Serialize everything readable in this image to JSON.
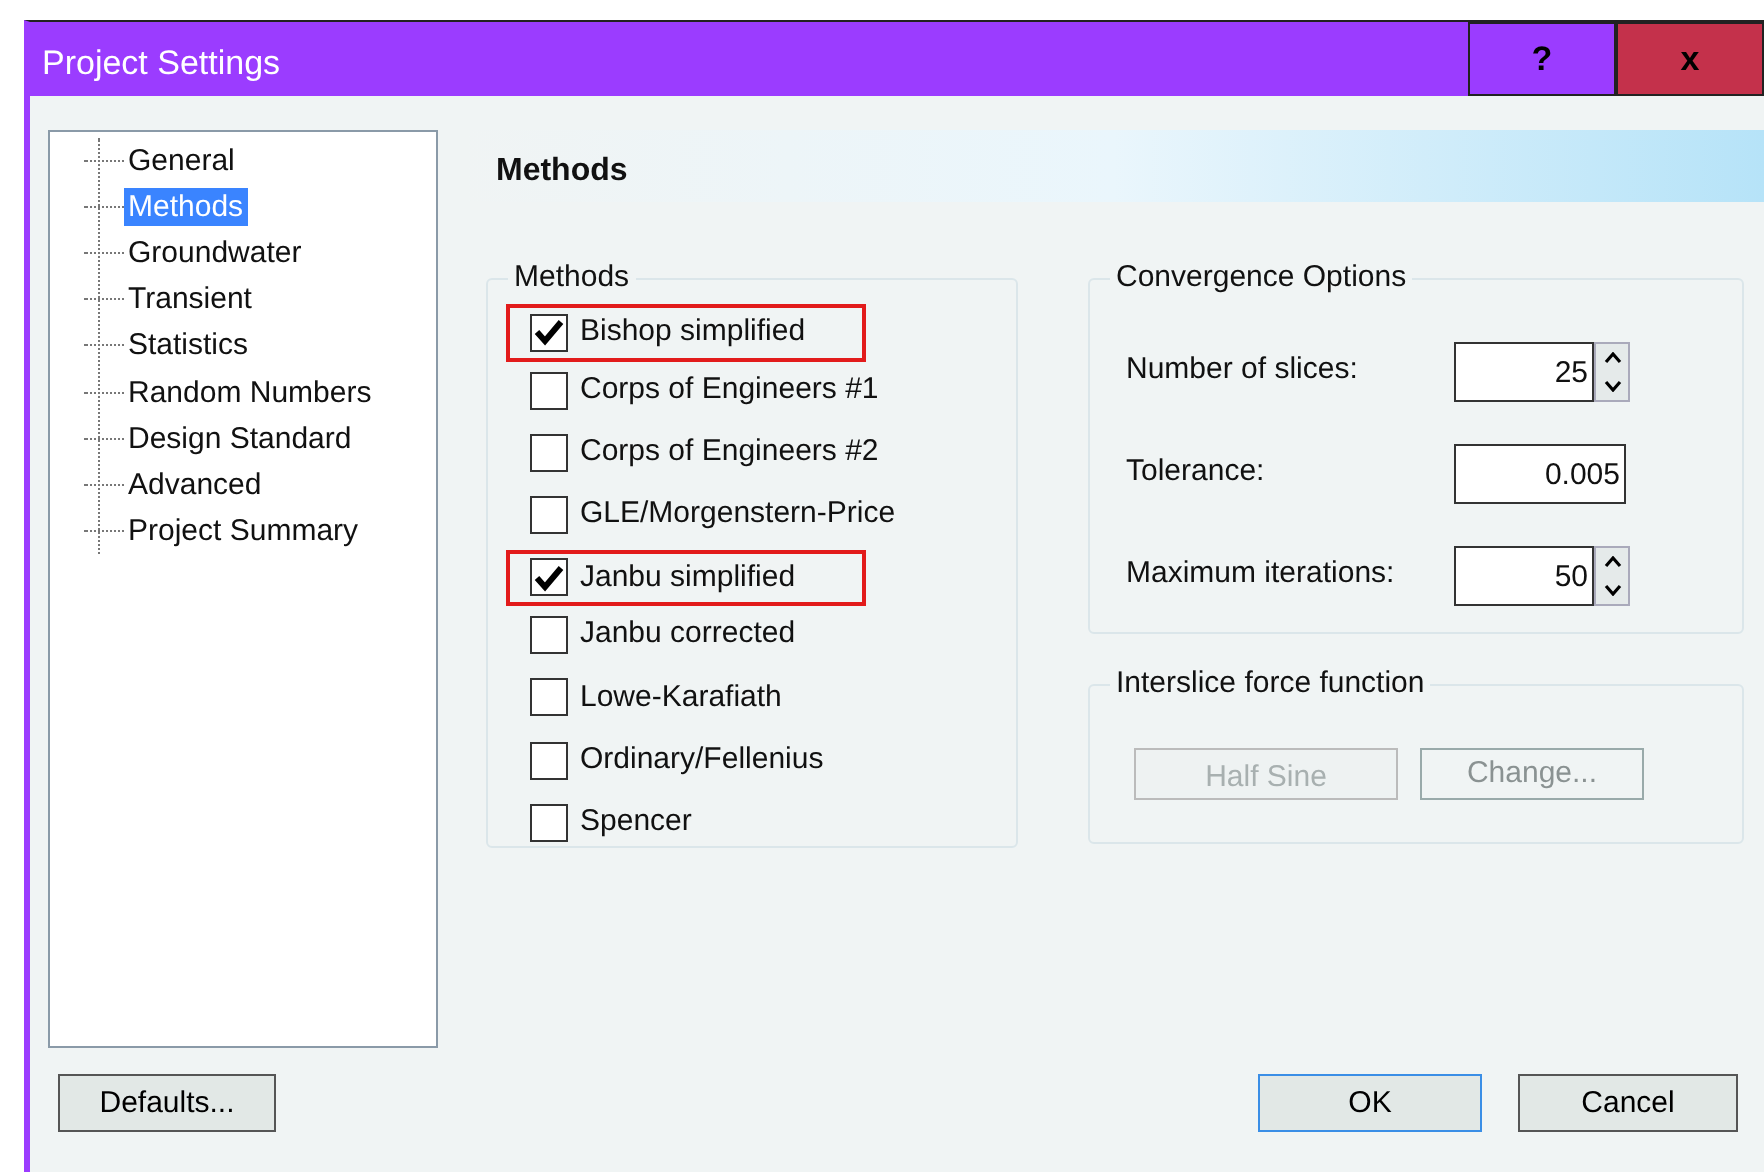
{
  "window": {
    "title": "Project Settings",
    "buttons": [
      "?",
      "x"
    ]
  },
  "sidebar": {
    "items": [
      {
        "label": "General",
        "selected": false
      },
      {
        "label": "Methods",
        "selected": true
      },
      {
        "label": "Groundwater",
        "selected": false
      },
      {
        "label": "Transient",
        "selected": false
      },
      {
        "label": "Statistics",
        "selected": false
      },
      {
        "label": "Random Numbers",
        "selected": false
      },
      {
        "label": "Design Standard",
        "selected": false
      },
      {
        "label": "Advanced",
        "selected": false
      },
      {
        "label": "Project Summary",
        "selected": false
      }
    ]
  },
  "page_title": "Methods",
  "methods": {
    "title": "Methods",
    "items": [
      {
        "label": "Bishop simplified",
        "checked": true,
        "highlighted": true
      },
      {
        "label": "Corps of Engineers #1",
        "checked": false,
        "highlighted": false
      },
      {
        "label": "Corps of Engineers #2",
        "checked": false,
        "highlighted": false
      },
      {
        "label": "GLE/Morgenstern-Price",
        "checked": false,
        "highlighted": false
      },
      {
        "label": "Janbu simplified",
        "checked": true,
        "highlighted": true
      },
      {
        "label": "Janbu corrected",
        "checked": false,
        "highlighted": false
      },
      {
        "label": "Lowe-Karafiath",
        "checked": false,
        "highlighted": false
      },
      {
        "label": "Ordinary/Fellenius",
        "checked": false,
        "highlighted": false
      },
      {
        "label": "Spencer",
        "checked": false,
        "highlighted": false
      }
    ]
  },
  "convergence": {
    "title": "Convergence Options",
    "fields": [
      {
        "label": "Number of slices:",
        "value": "25",
        "kind": "spin"
      },
      {
        "label": "Tolerance:",
        "value": "0.005",
        "kind": "text"
      },
      {
        "label": "Maximum iterations:",
        "value": "50",
        "kind": "spin"
      }
    ]
  },
  "interslice": {
    "title": "Interslice force function",
    "function": {
      "value": "Half Sine",
      "disabled": true
    },
    "change_button": {
      "label": "Change...",
      "disabled": true
    }
  },
  "buttons": [
    {
      "label": "Defaults...",
      "default": false
    },
    {
      "label": "OK",
      "default": true
    },
    {
      "label": "Cancel",
      "default": false
    }
  ]
}
